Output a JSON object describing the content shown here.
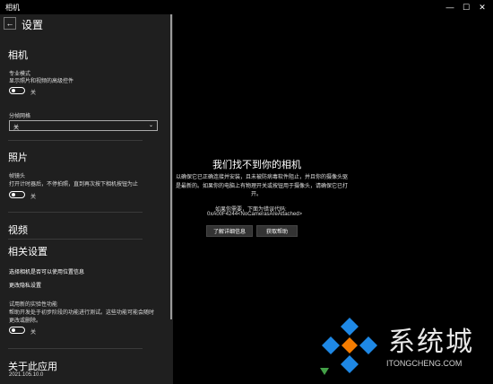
{
  "window": {
    "title": "相机",
    "minimize": "—",
    "maximize": "☐",
    "close": "✕"
  },
  "settings": {
    "back": "←",
    "title": "设置",
    "camera_heading": "相机",
    "pro_mode_label": "专业模式",
    "pro_mode_desc": "显示照片和视频的高级控件",
    "pro_mode_state": "关",
    "grid_label": "分帧网格",
    "grid_value": "关",
    "grid_chevron": "⌄",
    "photo_heading": "照片",
    "timelapse_label": "帧镜头",
    "timelapse_desc": "打开计时器后，不停拍照，直到再次按下相机按钮为止",
    "timelapse_state": "关",
    "video_heading": "视频",
    "related_heading": "相关设置",
    "link_location": "选择相机是否可以使用位置信息",
    "link_privacy": "更改隐私设置",
    "experimental_label": "试用新的实验性功能",
    "experimental_desc1": "帮助开发处于初步阶段的功能进行测试。这些功能可能会随时",
    "experimental_desc2": "更改或删除。",
    "experimental_state": "关",
    "about_heading": "关于此应用",
    "version": "2021.105.10.0"
  },
  "main": {
    "title": "我们找不到你的相机",
    "msg_line1": "以确保它已正确连接并安装，且未被防病毒软件阻止，并且你的摄像头驱",
    "msg_line2": "是最新的。如果你的电脑上有物理开关或按钮用于摄像头，请确保它已打",
    "msg_line3": "开。",
    "code_intro": "如果你需要，下面为错误代码:",
    "code": "0xA00F4244<NoCamerasAreAttached>",
    "details_button": "了解详细信息",
    "help_button": "获取帮助"
  },
  "watermark": {
    "name": "系统城",
    "url": "ITONGCHENG.COM"
  },
  "colors": {
    "panel_bg": "#1f1f1f",
    "main_bg": "#000000",
    "logo_blue": "#1e88e5",
    "logo_orange": "#f57c00",
    "logo_green": "#43a047"
  }
}
